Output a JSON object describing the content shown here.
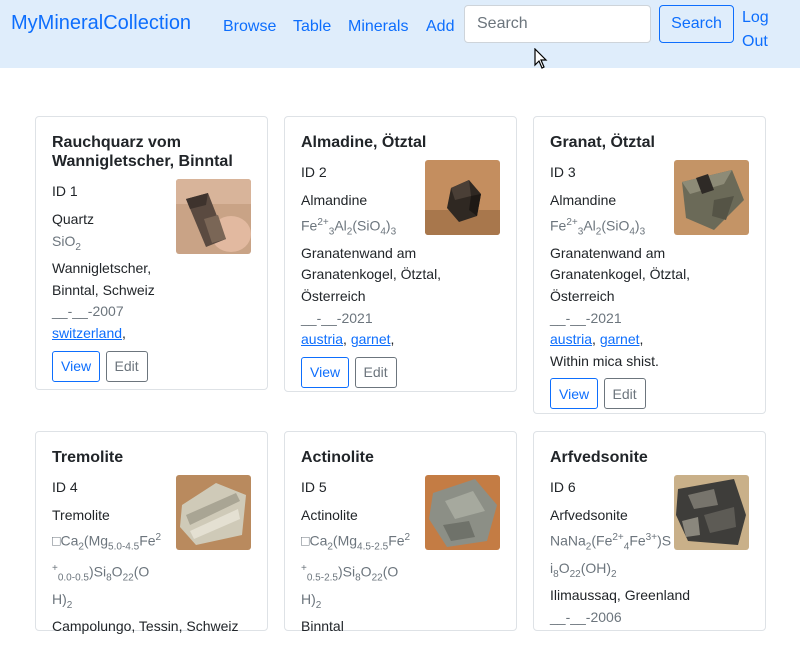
{
  "nav": {
    "brand": "MyMineralCollection",
    "links": [
      "Browse",
      "Table",
      "Minerals",
      "Add"
    ],
    "search_placeholder": "Search",
    "search_button": "Search",
    "logout": "Log Out"
  },
  "cards": [
    {
      "title": "Rauchquarz vom Wannigletscher, Binntal",
      "id": "ID 1",
      "mineral": "Quartz",
      "formula": "SiO2",
      "locality": "Wannigletscher, Binntal, Schweiz",
      "date": "__-__-2007",
      "tags": [
        "switzerland"
      ],
      "note": "",
      "view": "View",
      "edit": "Edit",
      "photo": "smoky-quartz-photo",
      "photo_colors": [
        "#c9a386",
        "#5a4a40"
      ]
    },
    {
      "title": "Almadine, Ötztal",
      "id": "ID 2",
      "mineral": "Almandine",
      "formula": "Fe2+3Al2(SiO4)3",
      "locality": "Granatenwand am Granatenkogel, Ötztal, Österreich",
      "date": "__-__-2021",
      "tags": [
        "austria",
        "garnet"
      ],
      "note": "",
      "view": "View",
      "edit": "Edit",
      "photo": "almandine-photo",
      "photo_colors": [
        "#c48e5f",
        "#2f2822"
      ]
    },
    {
      "title": "Granat, Ötztal",
      "id": "ID 3",
      "mineral": "Almandine",
      "formula": "Fe2+3Al2(SiO4)3",
      "locality": "Granatenwand am Granatenkogel, Ötztal, Österreich",
      "date": "__-__-2021",
      "tags": [
        "austria",
        "garnet"
      ],
      "note": "Within mica shist.",
      "view": "View",
      "edit": "Edit",
      "photo": "garnet-in-schist-photo",
      "photo_colors": [
        "#c49466",
        "#6b6a58"
      ]
    },
    {
      "title": "Tremolite",
      "id": "ID 4",
      "mineral": "Tremolite",
      "formula": "□Ca2(Mg5.0-4.5Fe2+0.0-0.5)Si8O22(OH)2",
      "locality": "Campolungo, Tessin, Schweiz",
      "photo": "tremolite-photo",
      "photo_colors": [
        "#b98a5e",
        "#cfcab8"
      ]
    },
    {
      "title": "Actinolite",
      "id": "ID 5",
      "mineral": "Actinolite",
      "formula": "□Ca2(Mg4.5-2.5Fe2+0.5-2.5)Si8O22(OH)2",
      "locality": "Binntal",
      "photo": "actinolite-photo",
      "photo_colors": [
        "#c47c44",
        "#8c8f86"
      ]
    },
    {
      "title": "Arfvedsonite",
      "id": "ID 6",
      "mineral": "Arfvedsonite",
      "formula": "NaNa2(Fe2+4Fe3+)Si8O22(OH)2",
      "locality": "Ilimaussaq, Greenland",
      "date": "__-__-2006",
      "photo": "arfvedsonite-photo",
      "photo_colors": [
        "#c9b089",
        "#3e3d3a"
      ]
    }
  ]
}
